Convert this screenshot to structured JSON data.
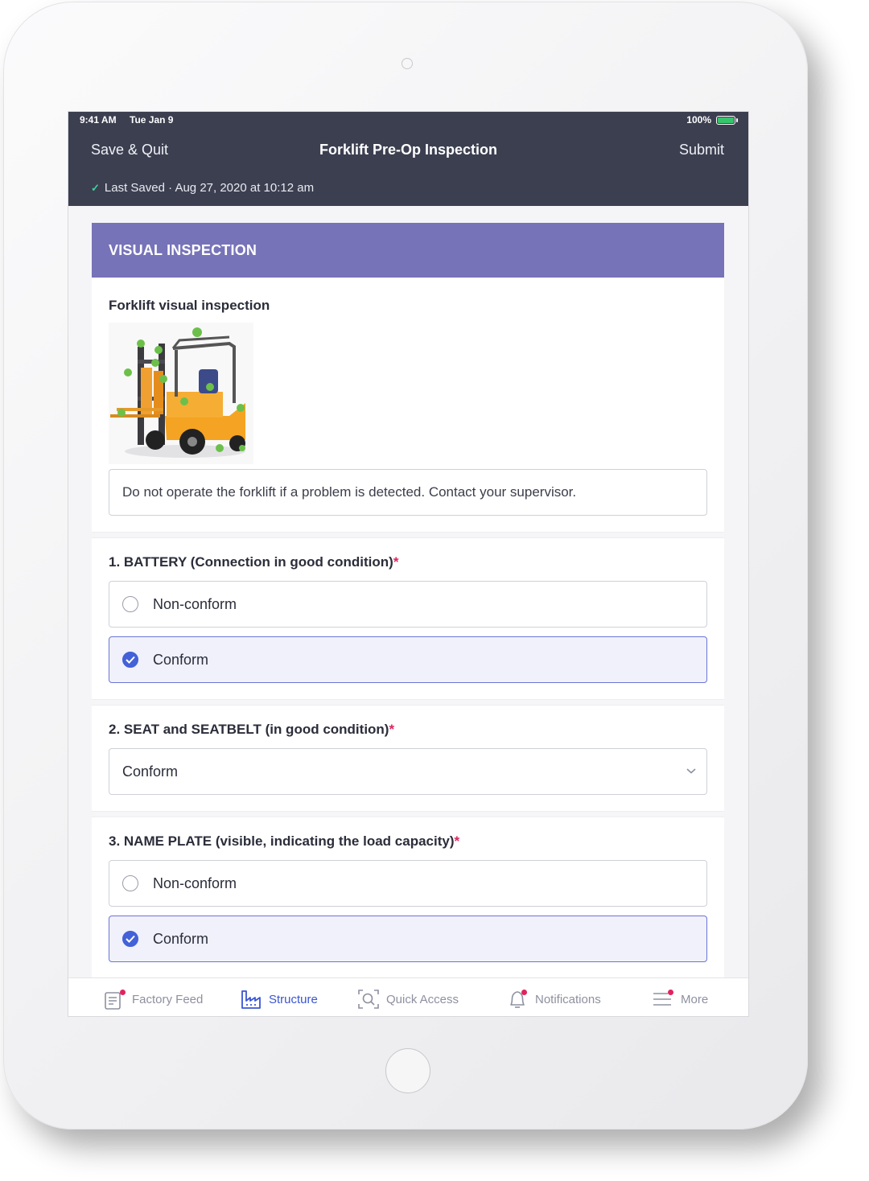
{
  "status_bar": {
    "time": "9:41 AM",
    "date": "Tue Jan 9",
    "battery": "100%"
  },
  "header": {
    "left_action": "Save & Quit",
    "title": "Forklift Pre-Op Inspection",
    "right_action": "Submit",
    "saved_text": "Last Saved · Aug 27, 2020 at 10:12 am"
  },
  "section": {
    "title": "VISUAL INSPECTION"
  },
  "intro": {
    "label": "Forklift visual inspection",
    "image_icon": "forklift-diagram",
    "notice": "Do not operate the forklift if a problem is detected. Contact your supervisor."
  },
  "questions": [
    {
      "number": "1.",
      "label": "1. BATTERY (Connection in good condition)",
      "required": "*",
      "type": "radio",
      "options": [
        "Non-conform",
        "Conform"
      ],
      "selected": "Conform"
    },
    {
      "number": "2.",
      "label": "2. SEAT and SEATBELT (in good condition)",
      "required": "*",
      "type": "select",
      "value": "Conform"
    },
    {
      "number": "3.",
      "label": "3. NAME PLATE (visible, indicating the load capacity)",
      "required": "*",
      "type": "radio",
      "options": [
        "Non-conform",
        "Conform"
      ],
      "selected": "Conform"
    }
  ],
  "tabbar": {
    "items": [
      {
        "label": "Factory Feed",
        "icon": "feed-icon",
        "badge": true,
        "active": false
      },
      {
        "label": "Structure",
        "icon": "factory-icon",
        "badge": false,
        "active": true
      },
      {
        "label": "Quick Access",
        "icon": "scan-search-icon",
        "badge": false,
        "active": false
      },
      {
        "label": "Notifications",
        "icon": "bell-icon",
        "badge": true,
        "active": false
      },
      {
        "label": "More",
        "icon": "menu-icon",
        "badge": true,
        "active": false
      }
    ]
  },
  "colors": {
    "header_bg": "#3c3f50",
    "section_bg": "#7673b8",
    "accent": "#4361d8",
    "required": "#e0245e",
    "selected_bg": "#f0f1fb"
  }
}
